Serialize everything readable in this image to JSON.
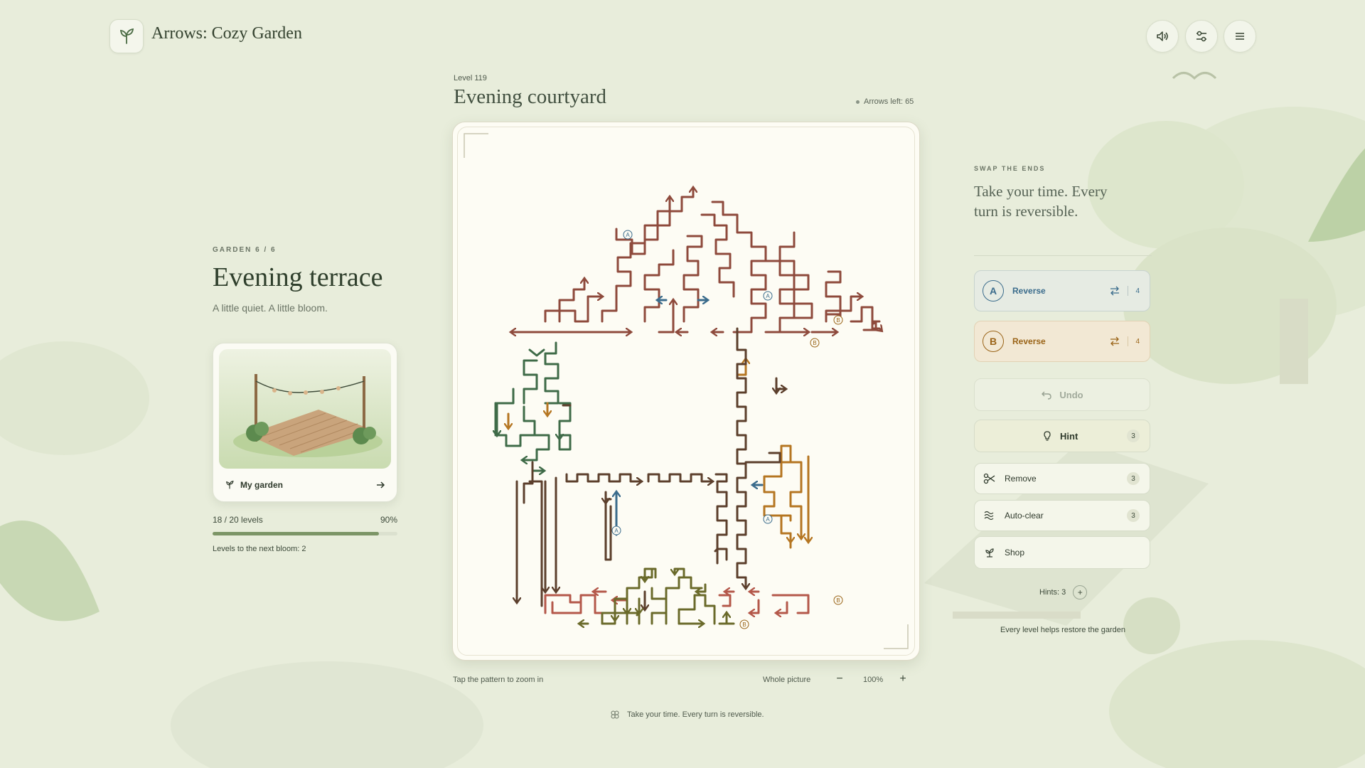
{
  "app": {
    "title": "Arrows: Cozy Garden"
  },
  "header": {
    "icons": [
      "sound-icon",
      "sliders-icon",
      "menu-icon"
    ]
  },
  "garden": {
    "eyebrow": "GARDEN 6 / 6",
    "title": "Evening terrace",
    "subtitle": "A little quiet. A little bloom.",
    "card_label": "My garden",
    "progress_label": "18 / 20 levels",
    "progress_percent": "90%",
    "progress_value": 0.9,
    "next_bloom": "Levels to the next bloom: 2"
  },
  "level": {
    "number": "Level 119",
    "title": "Evening courtyard",
    "arrows_left": "Arrows left: 65"
  },
  "board_footer": {
    "hint": "Tap the pattern to zoom in",
    "whole_picture": "Whole picture",
    "zoom_minus": "−",
    "zoom_value": "100%",
    "zoom_plus": "+"
  },
  "motto": "Take your time. Every turn is reversible.",
  "panel": {
    "eyebrow": "SWAP THE ENDS",
    "quote": "Take your time. Every turn is reversible.",
    "reverse_a": {
      "letter": "A",
      "label": "Reverse",
      "count": "4",
      "color": "#3b6c8c"
    },
    "reverse_b": {
      "letter": "B",
      "label": "Reverse",
      "count": "4",
      "color": "#9a6418"
    },
    "undo": "Undo",
    "hint": {
      "label": "Hint",
      "count": "3"
    },
    "remove": {
      "label": "Remove",
      "count": "3"
    },
    "auto_clear": {
      "label": "Auto-clear",
      "count": "3"
    },
    "shop": "Shop",
    "hints_text": "Hints: 3",
    "hints_plus": "+",
    "restore": "Every level helps restore the garden"
  },
  "puzzle": {
    "endpoint_markers": [
      {
        "letter": "A"
      },
      {
        "letter": "A"
      },
      {
        "letter": "A"
      },
      {
        "letter": "A"
      },
      {
        "letter": "B"
      },
      {
        "letter": "B"
      },
      {
        "letter": "B"
      },
      {
        "letter": "B"
      }
    ],
    "colors": {
      "roof": "#8e4a3c",
      "leaves": "#3f6b48",
      "trunk": "#5c3f2c",
      "orange": "#b57622",
      "blue": "#3b6c8c",
      "olive": "#6a6a2a",
      "rose": "#b4584a"
    }
  }
}
